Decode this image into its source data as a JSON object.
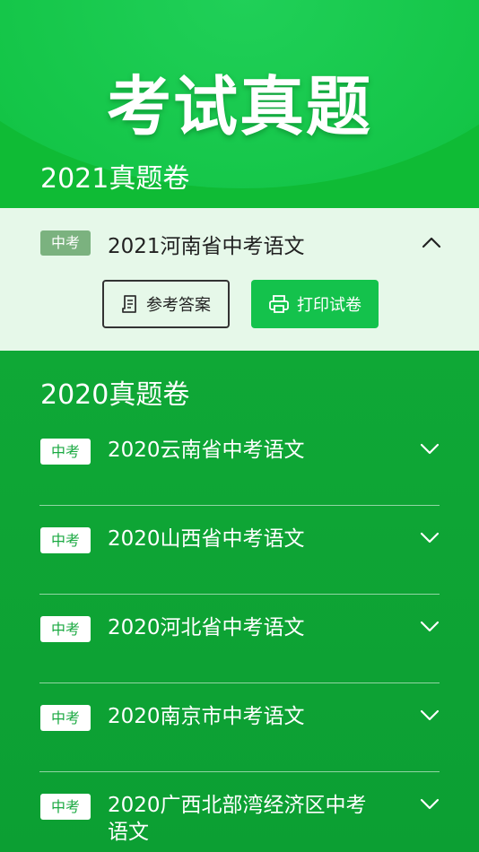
{
  "hero": {
    "title": "考试真题"
  },
  "sections": [
    {
      "title": "2021真题卷",
      "expanded_item": {
        "tag": "中考",
        "name": "2021河南省中考语文",
        "actions": {
          "answer_label": "参考答案",
          "print_label": "打印试卷"
        }
      }
    },
    {
      "title": "2020真题卷",
      "items": [
        {
          "tag": "中考",
          "name": "2020云南省中考语文"
        },
        {
          "tag": "中考",
          "name": "2020山西省中考语文"
        },
        {
          "tag": "中考",
          "name": "2020河北省中考语文"
        },
        {
          "tag": "中考",
          "name": "2020南京市中考语文"
        },
        {
          "tag": "中考",
          "name": "2020广西北部湾经济区中考语文"
        }
      ]
    }
  ],
  "icons": {
    "collapse": "chevron-up-icon",
    "expand": "chevron-down-icon",
    "answer": "document-icon",
    "print": "printer-icon"
  },
  "colors": {
    "primary_green": "#0fbb35",
    "button_green": "#14c24c",
    "expanded_bg": "#e6f8e9",
    "tag_muted": "#7bb27f"
  }
}
